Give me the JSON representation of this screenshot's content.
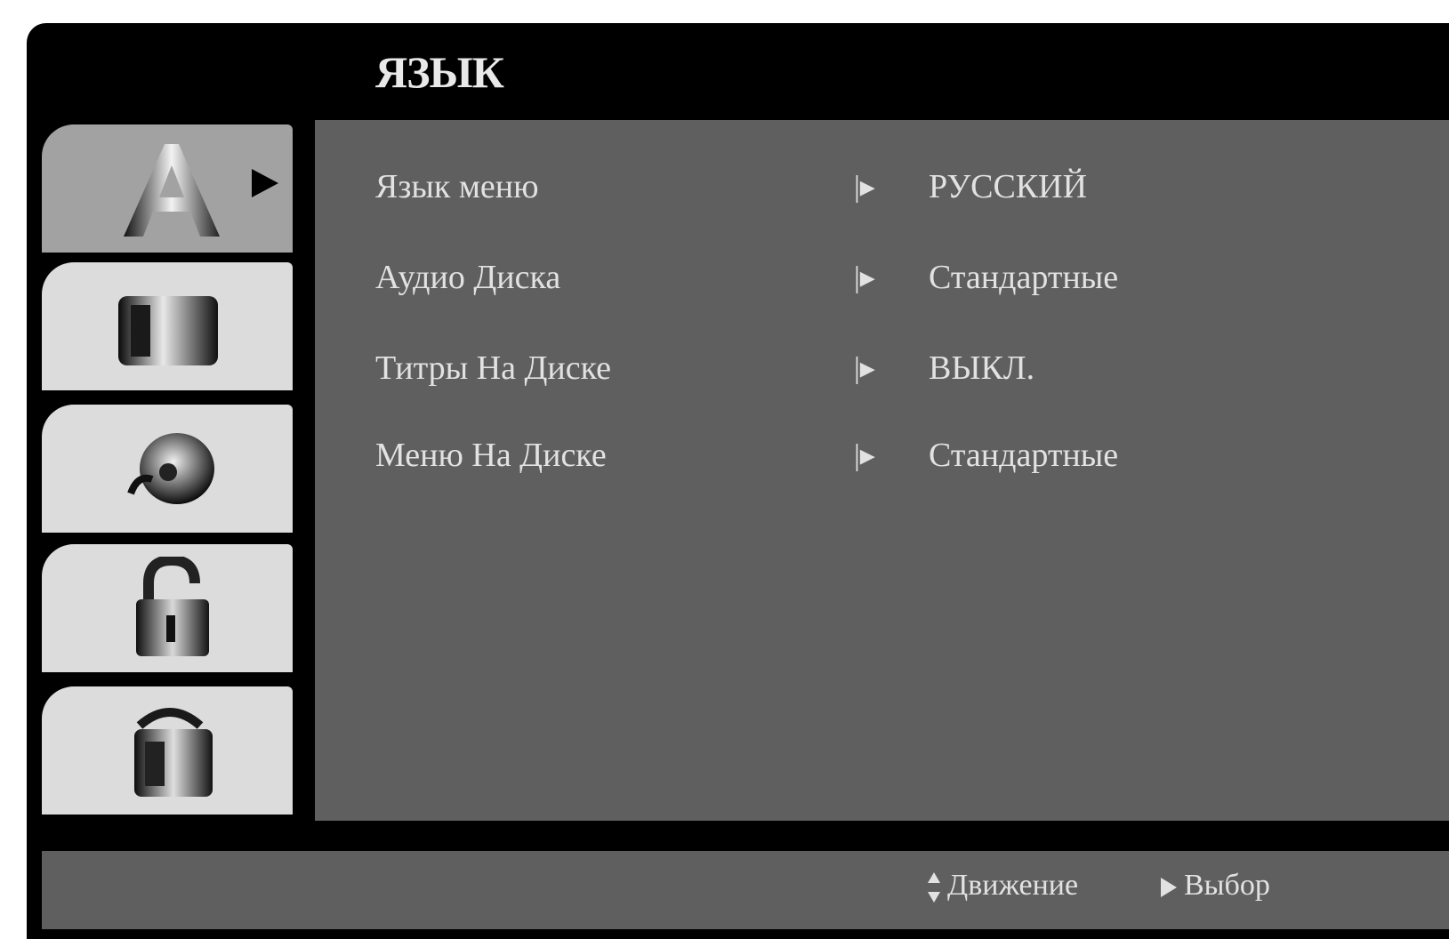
{
  "menu": {
    "title": "ЯЗЫК"
  },
  "tabs": [
    {
      "name": "language",
      "icon": "language-icon",
      "active": true
    },
    {
      "name": "display",
      "icon": "display-icon",
      "active": false
    },
    {
      "name": "audio",
      "icon": "audio-icon",
      "active": false
    },
    {
      "name": "lock",
      "icon": "lock-icon",
      "active": false
    },
    {
      "name": "others",
      "icon": "others-icon",
      "active": false
    }
  ],
  "settings": [
    {
      "label": "Язык меню",
      "value": "РУССКИЙ"
    },
    {
      "label": "Аудио Диска",
      "value": "Стандартные"
    },
    {
      "label": "Титры На Диске",
      "value": "ВЫКЛ."
    },
    {
      "label": "Меню На Диске",
      "value": "Стандартные"
    }
  ],
  "footer": {
    "move_label": "Движение",
    "select_label": "Выбор"
  },
  "colors": {
    "background": "#000000",
    "panel": "#5f5f5f",
    "tab_inactive": "#dcdcdc",
    "tab_active": "#a2a2a2",
    "text": "#e2e2e2"
  }
}
